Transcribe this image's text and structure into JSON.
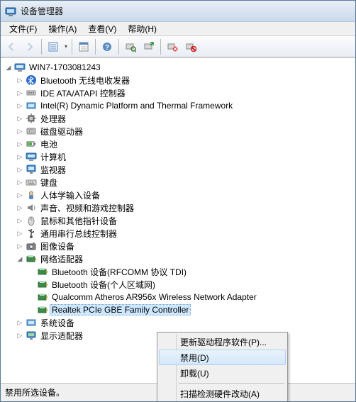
{
  "window": {
    "title": "设备管理器"
  },
  "menu": {
    "file": "文件(F)",
    "action": "操作(A)",
    "view": "查看(V)",
    "help": "帮助(H)"
  },
  "tree": {
    "root": "WIN7-1703081243",
    "categories": [
      {
        "label": "Bluetooth 无线电收发器",
        "icon": "bluetooth"
      },
      {
        "label": "IDE ATA/ATAPI 控制器",
        "icon": "ide"
      },
      {
        "label": "Intel(R) Dynamic Platform and Thermal Framework",
        "icon": "system"
      },
      {
        "label": "处理器",
        "icon": "cpu"
      },
      {
        "label": "磁盘驱动器",
        "icon": "disk"
      },
      {
        "label": "电池",
        "icon": "battery"
      },
      {
        "label": "计算机",
        "icon": "computer"
      },
      {
        "label": "监视器",
        "icon": "monitor"
      },
      {
        "label": "键盘",
        "icon": "keyboard"
      },
      {
        "label": "人体学输入设备",
        "icon": "hid"
      },
      {
        "label": "声音、视频和游戏控制器",
        "icon": "sound"
      },
      {
        "label": "鼠标和其他指针设备",
        "icon": "mouse"
      },
      {
        "label": "通用串行总线控制器",
        "icon": "usb"
      },
      {
        "label": "图像设备",
        "icon": "imaging"
      }
    ],
    "network": {
      "label": "网络适配器",
      "devices": [
        "Bluetooth 设备(RFCOMM 协议 TDI)",
        "Bluetooth 设备(个人区域网)",
        "Qualcomm Atheros AR956x Wireless Network Adapter",
        "Realtek PCIe GBE Family Controller"
      ]
    },
    "tail": [
      {
        "label": "系统设备",
        "icon": "system"
      },
      {
        "label": "显示适配器",
        "icon": "display"
      }
    ]
  },
  "contextmenu": {
    "update": "更新驱动程序软件(P)...",
    "disable": "禁用(D)",
    "uninstall": "卸载(U)",
    "scan": "扫描检测硬件改动(A)"
  },
  "statusbar": {
    "text": "禁用所选设备。"
  }
}
